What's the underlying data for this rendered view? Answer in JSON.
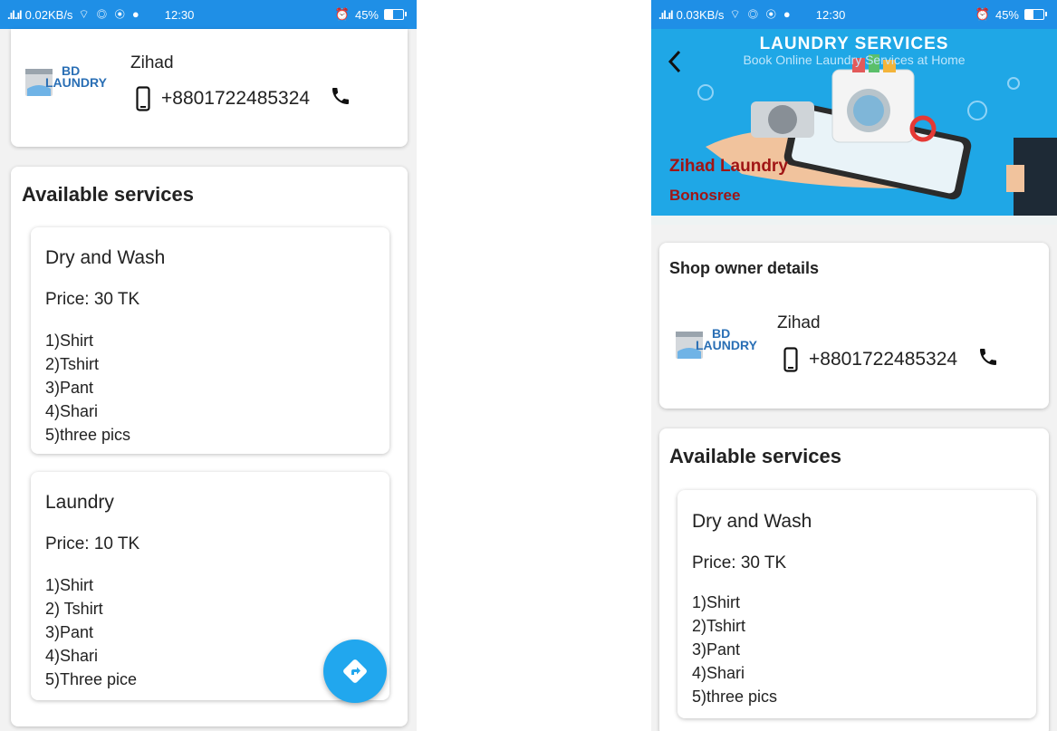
{
  "left": {
    "status": {
      "signal": ".ıl.ıl",
      "speed": "0.02KB/s",
      "time": "12:30",
      "battery": "45%",
      "battery_level": 0.45
    },
    "owner": {
      "logo_bd": "BD",
      "logo_word": "LAUNDRY",
      "name": "Zihad",
      "phone": "+8801722485324"
    },
    "services_title": "Available services",
    "services": [
      {
        "name": "Dry and Wash",
        "price": "Price:  30 TK",
        "items": [
          "1)Shirt",
          "2)Tshirt",
          "3)Pant",
          "4)Shari",
          "5)three pics"
        ]
      },
      {
        "name": "Laundry",
        "price": "Price:  10 TK",
        "items": [
          "1)Shirt",
          "2) Tshirt",
          "3)Pant",
          "4)Shari",
          "5)Three pice"
        ]
      }
    ],
    "fab_icon": "directions-icon"
  },
  "right": {
    "status": {
      "signal": ".ıl.ıl",
      "speed": "0.03KB/s",
      "time": "12:30",
      "battery": "45%",
      "battery_level": 0.45
    },
    "banner": {
      "title": "LAUNDRY SERVICES",
      "subtitle": "Book Online Laundry Services at Home",
      "shop_name": "Zihad Laundry",
      "shop_area": "Bonosree"
    },
    "owner_section_title": "Shop owner details",
    "owner": {
      "logo_bd": "BD",
      "logo_word": "LAUNDRY",
      "name": "Zihad",
      "phone": "+8801722485324"
    },
    "services_title": "Available services",
    "services": [
      {
        "name": "Dry and Wash",
        "price": "Price:  30 TK",
        "items": [
          "1)Shirt",
          "2)Tshirt",
          "3)Pant",
          "4)Shari",
          "5)three pics"
        ]
      }
    ]
  },
  "colors": {
    "status_bar": "#1f8fe6",
    "fab": "#21a7ee",
    "banner": "#1fa7e6",
    "shop_name": "#a01515",
    "logo": "#2a6fb5"
  }
}
